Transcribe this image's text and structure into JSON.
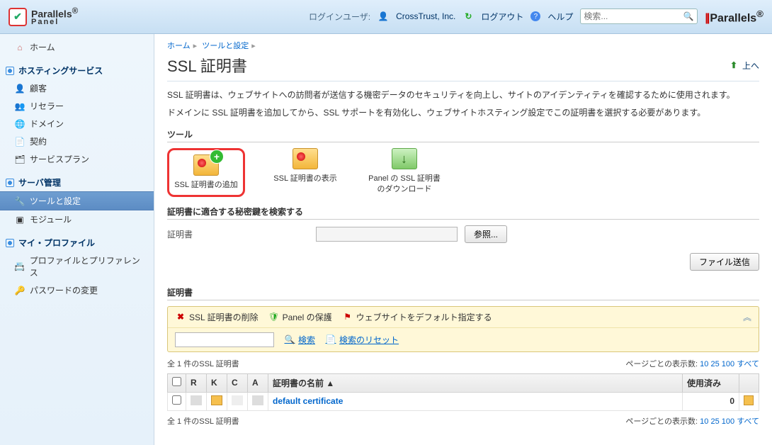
{
  "brand": {
    "line1": "Parallels",
    "line2": "Panel",
    "suffix": "®"
  },
  "top": {
    "login_label": "ログインユーザ:",
    "company": "CrossTrust, Inc.",
    "logout": "ログアウト",
    "help": "ヘルプ",
    "search_placeholder": "検索...",
    "parallels": "Parallels"
  },
  "sidebar": {
    "home": "ホーム",
    "g_hosting": "ホスティングサービス",
    "customers": "顧客",
    "resellers": "リセラー",
    "domains": "ドメイン",
    "contracts": "契約",
    "plans": "サービスプラン",
    "g_server": "サーバ管理",
    "tools": "ツールと設定",
    "modules": "モジュール",
    "g_profile": "マイ・プロファイル",
    "profile": "プロファイルとプリファレンス",
    "password": "パスワードの変更"
  },
  "crumbs": {
    "home": "ホーム",
    "tools": "ツールと設定"
  },
  "page": {
    "title": "SSL 証明書",
    "up": "上へ",
    "desc1": "SSL 証明書は、ウェブサイトへの訪問者が送信する機密データのセキュリティを向上し、サイトのアイデンティティを確認するために使用されます。",
    "desc2": "ドメインに SSL 証明書を追加してから、SSL サポートを有効化し、ウェブサイトホスティング設定でこの証明書を選択する必要があります。"
  },
  "tools": {
    "heading": "ツール",
    "add": "SSL 証明書の追加",
    "view": "SSL 証明書の表示",
    "download": "Panel の SSL 証明書のダウンロード"
  },
  "find": {
    "heading": "証明書に適合する秘密鍵を検索する",
    "label": "証明書",
    "browse": "参照...",
    "send": "ファイル送信"
  },
  "list": {
    "heading": "証明書",
    "del": "SSL 証明書の削除",
    "protect": "Panel の保護",
    "default": "ウェブサイトをデフォルト指定する",
    "search": "検索",
    "reset": "検索のリセット",
    "count": "全 1 件のSSL 証明書",
    "per_page_label": "ページごとの表示数:",
    "per_page": [
      "10",
      "25",
      "100",
      "すべて"
    ],
    "cols": {
      "r": "R",
      "k": "K",
      "c": "C",
      "a": "A",
      "name": "証明書の名前",
      "used": "使用済み"
    },
    "sort_indicator": "▲",
    "rows": [
      {
        "name": "default certificate",
        "used": 0
      }
    ]
  }
}
